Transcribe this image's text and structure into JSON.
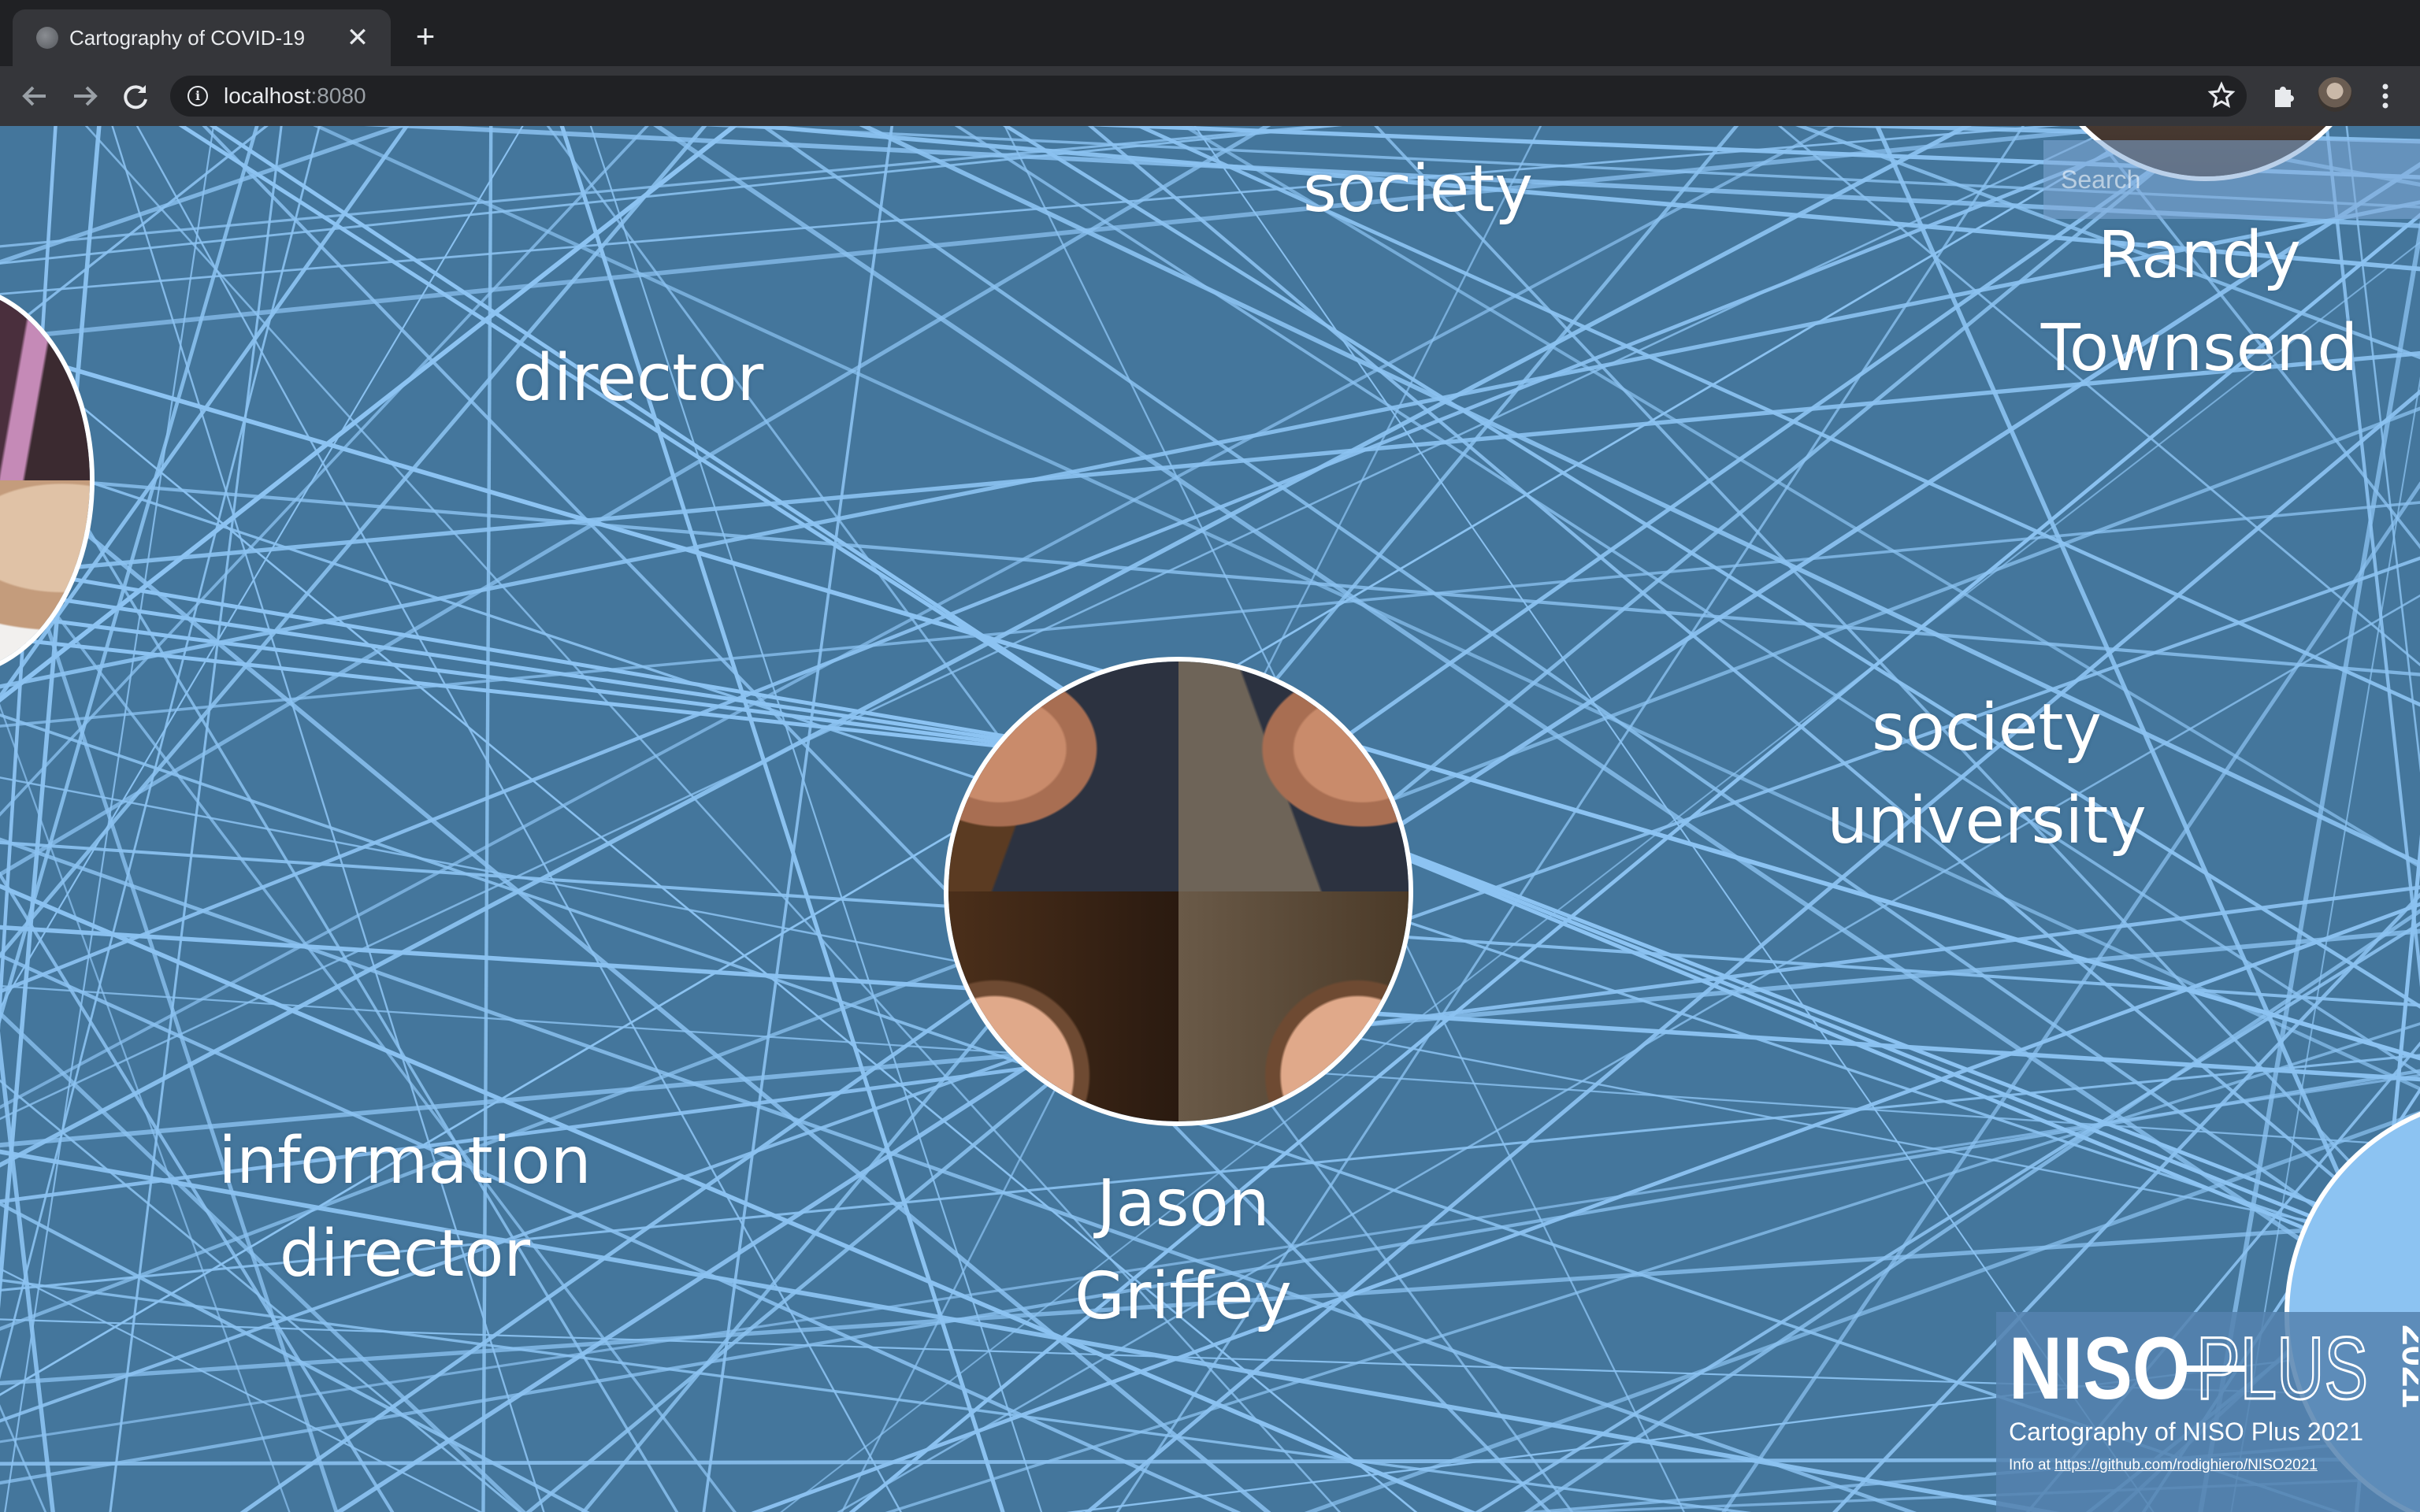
{
  "browser": {
    "tab_title": "Cartography of COVID-19",
    "close_glyph": "✕",
    "new_tab_glyph": "+",
    "url_host": "localhost",
    "url_port": ":8080",
    "icons": [
      "back-arrow-icon",
      "forward-arrow-icon",
      "reload-icon",
      "info-icon",
      "star-icon",
      "extensions-icon",
      "profile-avatar",
      "kebab-menu-icon"
    ]
  },
  "map": {
    "background_color": "#44769c",
    "line_color": "#8cc3f2",
    "search_placeholder": "Search",
    "nodes": {
      "center_person": "Jason Griffey",
      "top_right_person": "Randy Townsend"
    },
    "keywords": {
      "society_top": "society",
      "director": "director",
      "society_university_1": "society",
      "society_university_2": "university",
      "information_director_1": "information",
      "information_director_2": "director"
    },
    "person_names": {
      "jason_1": "Jason",
      "jason_2": "Griffey",
      "randy_1": "Randy",
      "randy_2": "Townsend"
    }
  },
  "footer": {
    "logo_text": "NISO PLUS 2021",
    "subtitle": "Cartography of NISO Plus 2021",
    "info_prefix": "Info at ",
    "info_link": "https://github.com/rodighiero/NISO2021"
  }
}
